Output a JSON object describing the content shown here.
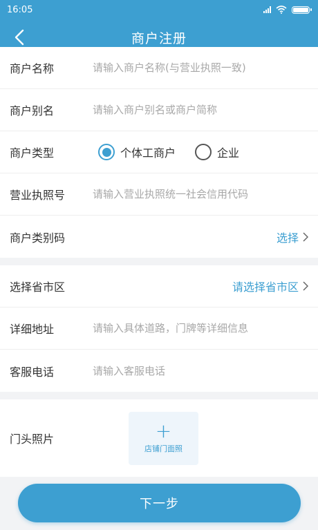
{
  "status_bar": {
    "time": "16:05"
  },
  "header": {
    "title": "商户注册"
  },
  "form": {
    "merchant_name": {
      "label": "商户名称",
      "placeholder": "请输入商户名称(与营业执照一致)"
    },
    "merchant_alias": {
      "label": "商户别名",
      "placeholder": "请输入商户别名或商户简称"
    },
    "merchant_type": {
      "label": "商户类型",
      "options": [
        "个体工商户",
        "企业"
      ],
      "selected": "个体工商户"
    },
    "license_number": {
      "label": "营业执照号",
      "placeholder": "请输入营业执照统一社会信用代码"
    },
    "category_code": {
      "label": "商户类别码",
      "action": "选择"
    },
    "region": {
      "label": "选择省市区",
      "action": "请选择省市区"
    },
    "address": {
      "label": "详细地址",
      "placeholder": "请输入具体道路，门牌等详细信息"
    },
    "service_phone": {
      "label": "客服电话",
      "placeholder": "请输入客服电话"
    },
    "storefront_photo": {
      "label": "门头照片",
      "upload_hint": "店铺门面照"
    }
  },
  "footer": {
    "next_label": "下一步"
  },
  "colors": {
    "accent": "#3d9fd1",
    "background": "#f2f3f5"
  }
}
